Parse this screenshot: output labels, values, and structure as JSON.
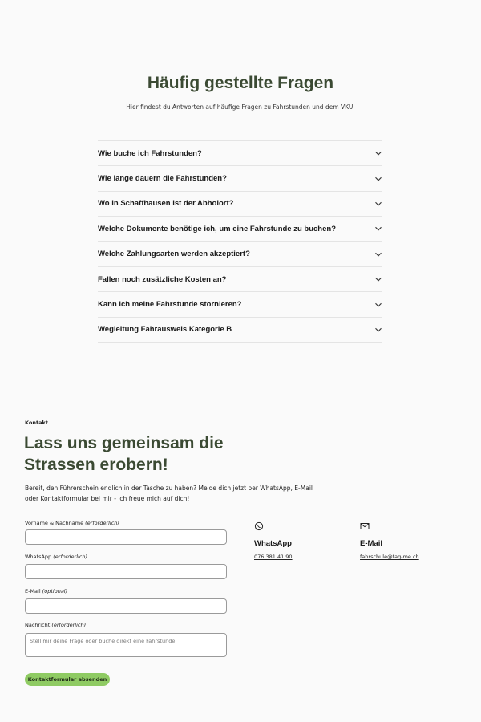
{
  "faq": {
    "title": "Häufig gestellte Fragen",
    "subtitle": "Hier findest du Antworten auf häufige Fragen zu Fahrstunden und dem VKU.",
    "items": [
      {
        "question": "Wie buche ich Fahrstunden?"
      },
      {
        "question": "Wie lange dauern die Fahrstunden?"
      },
      {
        "question": "Wo in Schaffhausen ist der Abholort?"
      },
      {
        "question": "Welche Dokumente benötige ich, um eine Fahrstunde zu buchen?"
      },
      {
        "question": "Welche Zahlungsarten werden akzeptiert?"
      },
      {
        "question": "Fallen noch zusätzliche Kosten an?"
      },
      {
        "question": "Kann ich meine Fahrstunde stornieren?"
      },
      {
        "question": "Wegleitung Fahrausweis Kategorie B"
      }
    ],
    "expand_icon": "chevron-down-icon"
  },
  "contact": {
    "eyebrow": "Kontakt",
    "heading": "Lass uns gemeinsam die Strassen erobern!",
    "intro": "Bereit, den Führerschein endlich in der Tasche zu haben? Melde dich jetzt per WhatsApp, E-Mail oder Kontaktformular bei mir - ich freue mich auf dich!",
    "form": {
      "name_label": "Vorname & Nachname",
      "name_hint": "(erforderlich)",
      "whatsapp_label": "WhatsApp",
      "whatsapp_hint": "(erforderlich)",
      "email_label": "E-Mail",
      "email_hint": "(optional)",
      "message_label": "Nachricht",
      "message_hint": "(erforderlich)",
      "message_placeholder": "Stell mir deine Frage oder buche direkt eine Fahrstunde.",
      "submit_label": "Kontaktformular absenden"
    },
    "whatsapp": {
      "title": "WhatsApp",
      "number": "076 381 41 90",
      "icon": "whatsapp-icon"
    },
    "email": {
      "title": "E-Mail",
      "address": "fahrschule@tag-me.ch",
      "icon": "mail-icon"
    }
  },
  "colors": {
    "heading_green": "#3b4a33",
    "button_green": "#8fcb63",
    "background": "#fafafa"
  }
}
